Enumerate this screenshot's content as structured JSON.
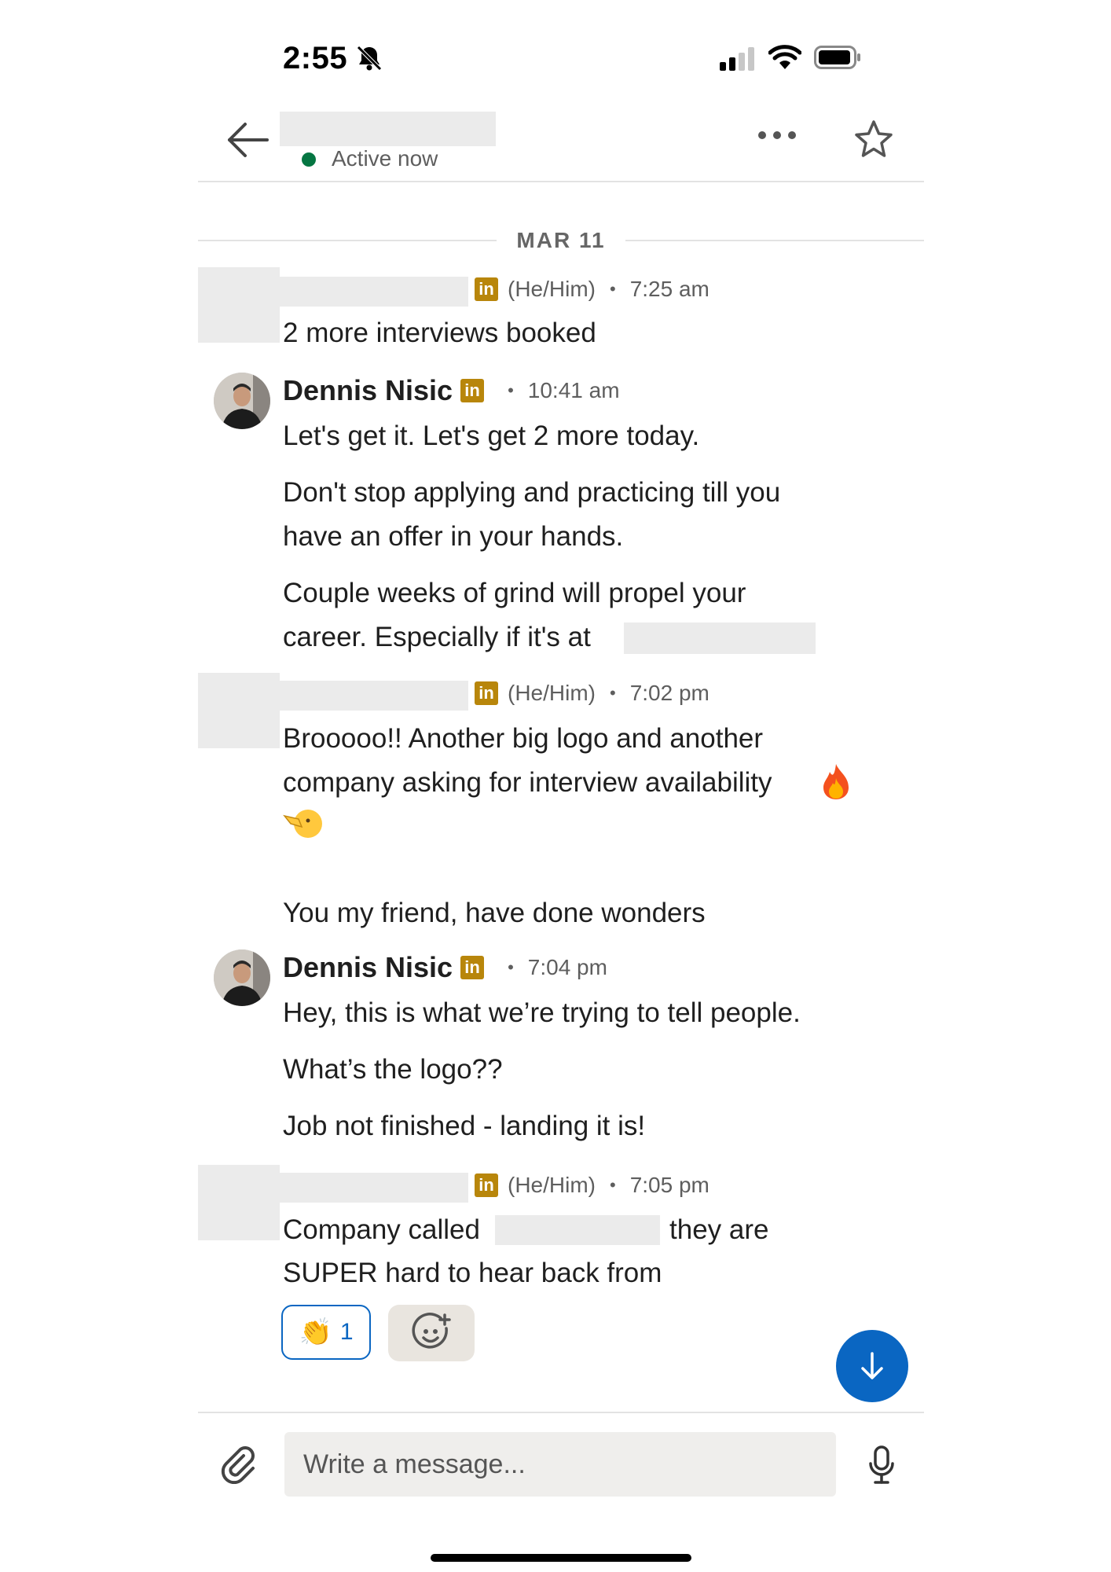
{
  "status_bar": {
    "time": "2:55"
  },
  "header": {
    "presence": "Active now"
  },
  "date_separator": "MAR 11",
  "messages": [
    {
      "pronouns": "(He/Him)",
      "time": "7:25 am",
      "text": "2 more interviews booked"
    },
    {
      "sender": "Dennis Nisic",
      "time": "10:41 am",
      "lines": [
        "Let's get it. Let's get 2 more today.",
        "Don't stop applying and practicing till you",
        "have an offer in your hands.",
        "Couple weeks of grind will propel your",
        "career. Especially if it's at"
      ]
    },
    {
      "pronouns": "(He/Him)",
      "time": "7:02 pm",
      "lines": [
        "Brooooo!! Another big logo and another",
        "company asking for interview availability",
        "You my friend, have done wonders"
      ]
    },
    {
      "sender": "Dennis Nisic",
      "time": "7:04 pm",
      "lines": [
        "Hey, this is what we’re trying to tell people.",
        "What’s the logo??",
        "Job not finished - landing it is!"
      ]
    },
    {
      "pronouns": "(He/Him)",
      "time": "7:05 pm",
      "lines": [
        "Company called",
        "they are",
        "SUPER hard to hear back from"
      ]
    }
  ],
  "reaction": {
    "emoji": "👏",
    "count": "1"
  },
  "composer": {
    "placeholder": "Write a message..."
  },
  "icons": [
    "back-arrow-icon",
    "more-icon",
    "star-icon",
    "linkedin-icon",
    "fire-emoji",
    "pointing-emoji",
    "add-reaction-icon",
    "arrow-down-icon",
    "paperclip-icon",
    "microphone-icon"
  ],
  "colors": {
    "accent": "#0a66c2",
    "presence": "#057642",
    "linkedin_badge": "#b8860b"
  }
}
